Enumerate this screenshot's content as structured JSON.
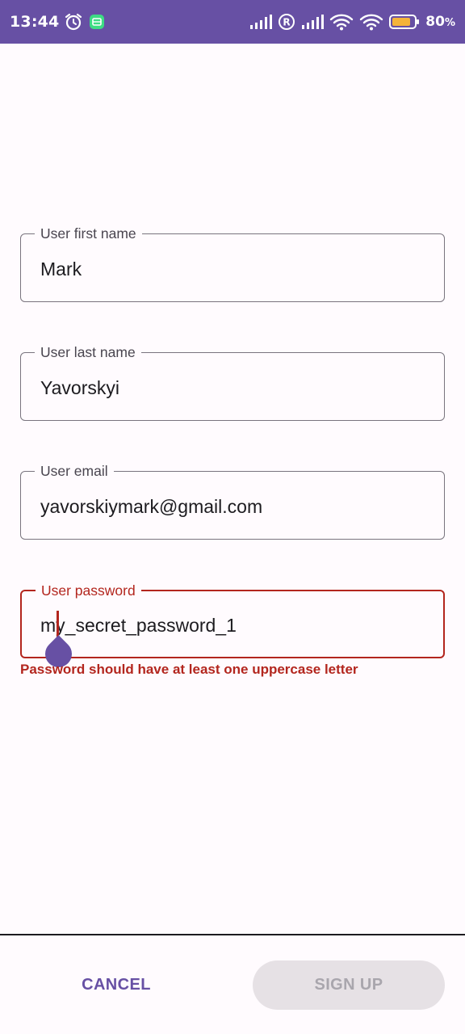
{
  "status_bar": {
    "time": "13:44",
    "battery_percent": "80",
    "battery_percent_suffix": "%",
    "icons": [
      "alarm-icon",
      "notification-app-icon",
      "signal-icon",
      "roaming-icon",
      "signal-icon",
      "wifi-icon",
      "wifi-icon",
      "battery-icon"
    ],
    "background": "#6750a4"
  },
  "form": {
    "first_name": {
      "label": "User first name",
      "value": "Mark"
    },
    "last_name": {
      "label": "User last name",
      "value": "Yavorskyi"
    },
    "email": {
      "label": "User email",
      "value": "yavorskiymark@gmail.com"
    },
    "password": {
      "label": "User password",
      "value": "my_secret_password_1",
      "error": "Password should have at least one uppercase letter"
    }
  },
  "actions": {
    "cancel_label": "CANCEL",
    "signup_label": "SIGN UP",
    "signup_enabled": false
  },
  "colors": {
    "primary": "#6750a4",
    "error": "#b3261e",
    "outline": "#79747e",
    "surface": "#fffbfe",
    "disabled_bg": "#e6e1e5"
  }
}
